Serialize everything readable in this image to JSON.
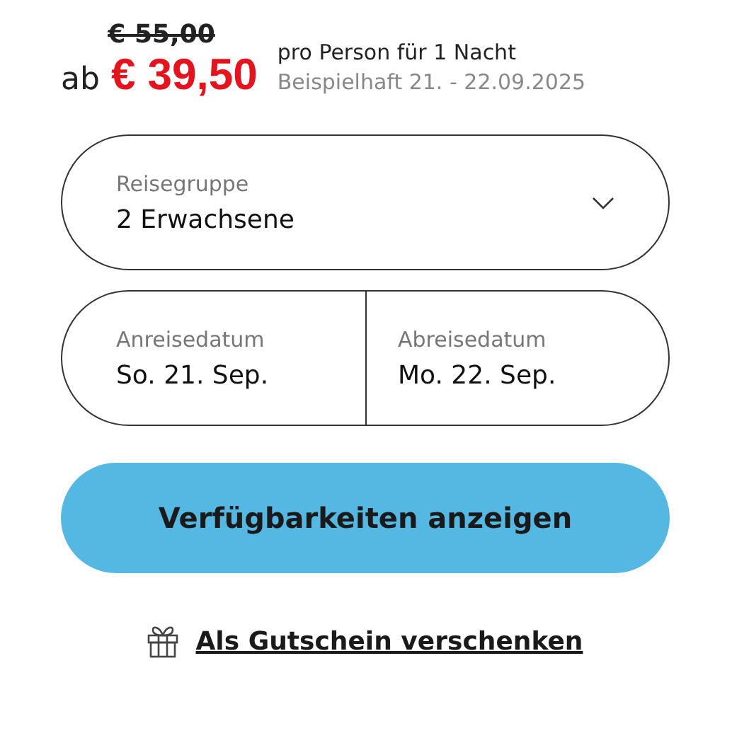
{
  "price": {
    "old": "€ 55,00",
    "prefix": "ab",
    "current": "€ 39,50",
    "per": "pro Person für 1 Nacht",
    "example": "Beispielhaft 21. - 22.09.2025"
  },
  "group": {
    "label": "Reisegruppe",
    "value": "2 Erwachsene"
  },
  "dates": [
    {
      "label": "Anreisedatum",
      "value": "So. 21. Sep."
    },
    {
      "label": "Abreisedatum",
      "value": "Mo. 22. Sep."
    }
  ],
  "button": "Verfügbarkeiten anzeigen",
  "gift_link": "Als Gutschein verschenken"
}
